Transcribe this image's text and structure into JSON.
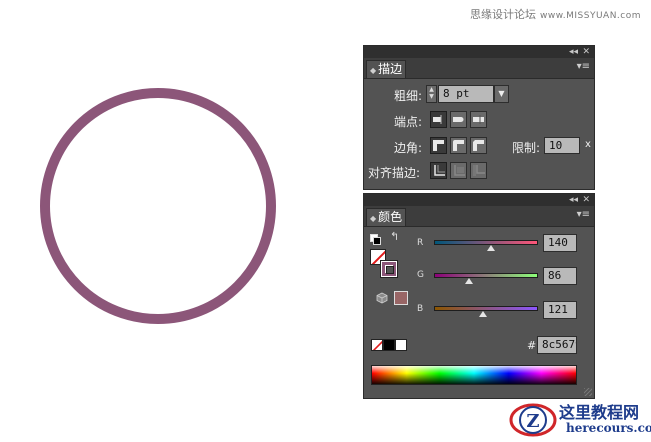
{
  "watermark": {
    "site_cn": "思缘设计论坛",
    "site_en": "www.MISSYUAN.com"
  },
  "artwork": {
    "shape": "circle",
    "stroke_color": "#8c5679",
    "fill": "none"
  },
  "stroke_panel": {
    "collapse_icon": "double-chevron-left-icon",
    "close_icon": "close-icon",
    "tab_label": "描边",
    "menu_icon": "panel-menu-icon",
    "weight": {
      "label": "粗细:",
      "value": "8 pt"
    },
    "cap": {
      "label": "端点:",
      "options": [
        "butt-cap-icon",
        "round-cap-icon",
        "projecting-cap-icon"
      ],
      "selected": 0
    },
    "corner": {
      "label": "边角:",
      "options": [
        "miter-join-icon",
        "round-join-icon",
        "bevel-join-icon"
      ],
      "selected": 0
    },
    "limit": {
      "label": "限制:",
      "value": "10",
      "suffix": "x"
    },
    "align": {
      "label": "对齐描边:",
      "options": [
        "align-center-icon",
        "align-inside-icon",
        "align-outside-icon"
      ],
      "selected": 0
    }
  },
  "color_panel": {
    "collapse_icon": "double-chevron-left-icon",
    "close_icon": "close-icon",
    "tab_label": "颜色",
    "menu_icon": "panel-menu-icon",
    "channels": [
      {
        "label": "R",
        "value": "140",
        "level": 0.549
      },
      {
        "label": "G",
        "value": "86",
        "level": 0.337
      },
      {
        "label": "B",
        "value": "121",
        "level": 0.475
      }
    ],
    "hex_label": "#",
    "hex_value": "8c5679",
    "stroke_swatch": "#8c5679",
    "fill_swatch": "none",
    "out_of_gamut_icon": "web-safe-cube-icon",
    "quick_swatches": [
      "none",
      "#000000",
      "#ffffff"
    ]
  },
  "logo": {
    "cn": "这里教程网",
    "en": "herecours.com"
  }
}
